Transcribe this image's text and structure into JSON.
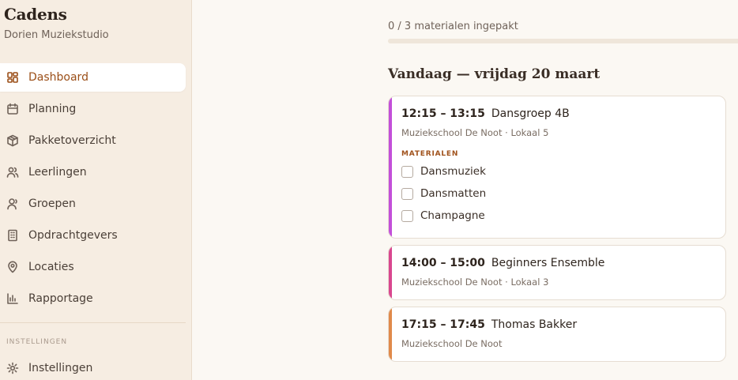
{
  "sidebar": {
    "brand": {
      "title": "Cadens",
      "subtitle": "Dorien Muziekstudio"
    },
    "items": [
      {
        "label": "Dashboard",
        "icon": "dashboard-icon",
        "active": true
      },
      {
        "label": "Planning",
        "icon": "calendar-icon"
      },
      {
        "label": "Pakketoverzicht",
        "icon": "package-icon"
      },
      {
        "label": "Leerlingen",
        "icon": "users-icon"
      },
      {
        "label": "Groepen",
        "icon": "group-icon"
      },
      {
        "label": "Opdrachtgevers",
        "icon": "building-icon"
      },
      {
        "label": "Locaties",
        "icon": "map-pin-icon"
      },
      {
        "label": "Rapportage",
        "icon": "bar-chart-icon"
      }
    ],
    "section_label": "INSTELLINGEN",
    "settings": {
      "label": "Instellingen",
      "icon": "gear-icon"
    }
  },
  "main": {
    "progress": {
      "text": "0 / 3 materialen ingepakt",
      "packed": 0,
      "total": 3
    },
    "day_title": "Vandaag — vrijdag 20 maart",
    "events": [
      {
        "time": "12:15 – 13:15",
        "title": "Dansgroep 4B",
        "location": "Muziekschool De Noot · Lokaal 5",
        "accent": "#c34fd9",
        "materials_label": "MATERIALEN",
        "materials": [
          "Dansmuziek",
          "Dansmatten",
          "Champagne"
        ]
      },
      {
        "time": "14:00 – 15:00",
        "title": "Beginners Ensemble",
        "location": "Muziekschool De Noot · Lokaal 3",
        "accent": "#d9478f"
      },
      {
        "time": "17:15 – 17:45",
        "title": "Thomas Bakker",
        "location": "Muziekschool De Noot",
        "accent": "#e08a4a"
      }
    ]
  },
  "colors": {
    "sidebar_bg": "#f6ede2",
    "page_bg": "#fbf8f3",
    "active_text": "#9b4f18",
    "progress_fill": "#c77a3b"
  }
}
